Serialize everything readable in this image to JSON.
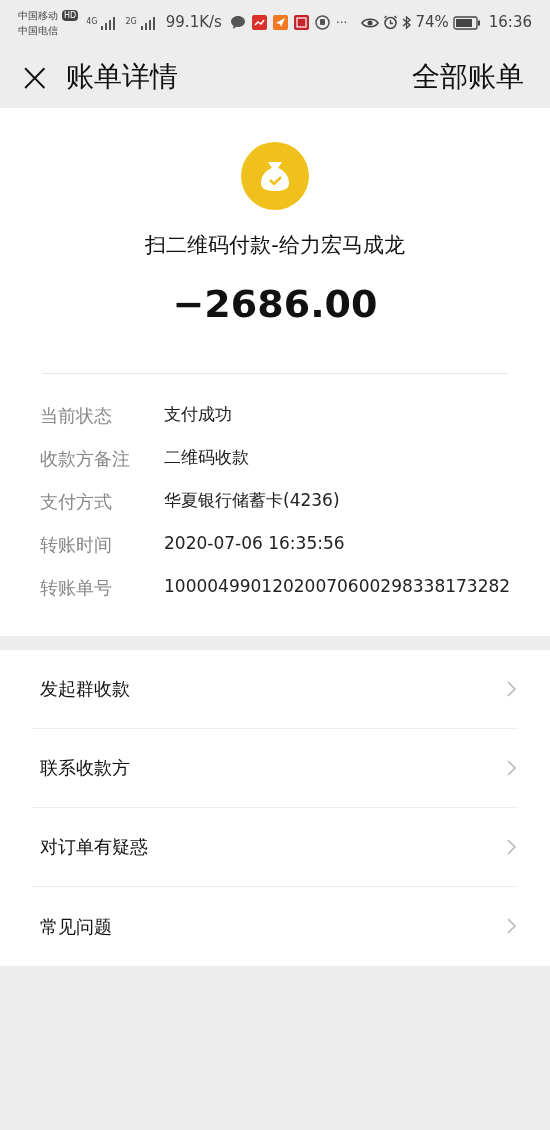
{
  "status_bar": {
    "carriers": [
      "中国移动",
      "中国电信"
    ],
    "hd_badge": "HD",
    "network_types": [
      "4G",
      "2G"
    ],
    "speed": "99.1K/s",
    "more": "···",
    "battery": "74%",
    "time": "16:36"
  },
  "header": {
    "close": "×",
    "title": "账单详情",
    "action": "全部账单"
  },
  "summary": {
    "title": "扫二维码付款-给力宏马成龙",
    "amount": "−2686.00"
  },
  "details": [
    {
      "label": "当前状态",
      "value": "支付成功"
    },
    {
      "label": "收款方备注",
      "value": "二维码收款"
    },
    {
      "label": "支付方式",
      "value": "华夏银行储蓄卡(4236)"
    },
    {
      "label": "转账时间",
      "value": "2020-07-06 16:35:56"
    },
    {
      "label": "转账单号",
      "value": "10000499012020070600298338173282"
    }
  ],
  "actions": [
    "发起群收款",
    "联系收款方",
    "对订单有疑惑",
    "常见问题"
  ]
}
